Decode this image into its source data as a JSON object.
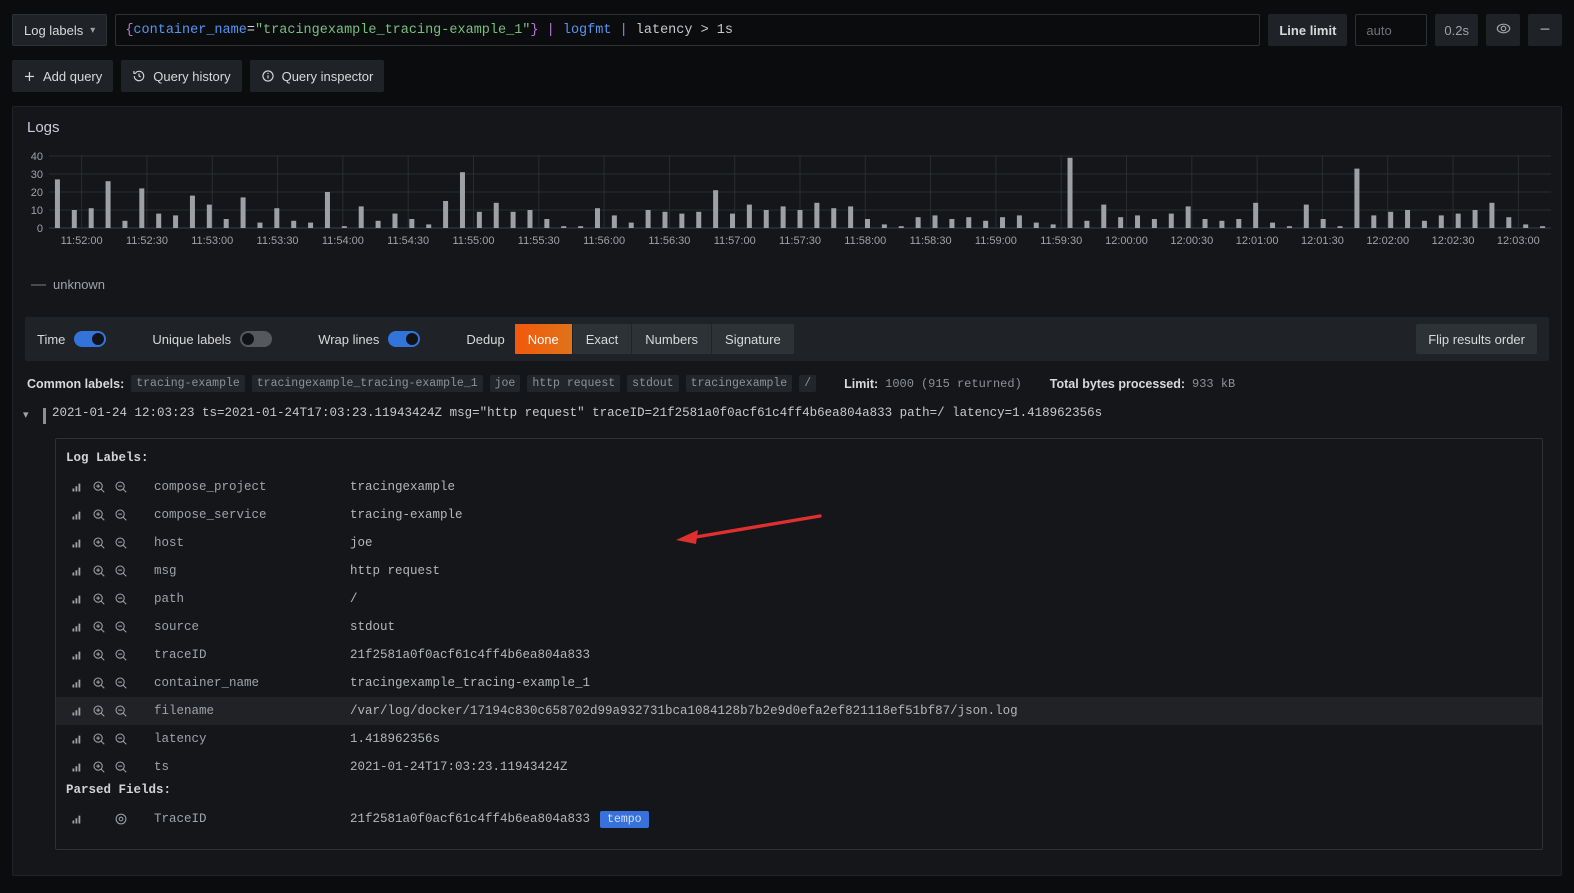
{
  "toolbar": {
    "log_labels_label": "Log labels",
    "chevron_icon": "chevron-down-icon",
    "query": {
      "brace_open": "{",
      "label": "container_name",
      "equals": "=",
      "string": "\"tracingexample_tracing-example_1\"",
      "brace_close": "}",
      "pipe1": "|",
      "parser": "logfmt",
      "pipe2": "|",
      "filter": "latency > 1s"
    },
    "line_limit_label": "Line limit",
    "line_limit_placeholder": "auto",
    "interval": "0.2s",
    "eye_icon": "eye-icon",
    "collapse_icon": "minus-icon"
  },
  "actions": [
    {
      "label": "Add query",
      "icon": "plus-icon"
    },
    {
      "label": "Query history",
      "icon": "history-icon"
    },
    {
      "label": "Query inspector",
      "icon": "info-circle-icon"
    }
  ],
  "panel": {
    "title": "Logs",
    "legend": {
      "dash": "—",
      "label": "unknown"
    }
  },
  "chart_data": {
    "type": "bar",
    "title": "Logs",
    "xlabel": "",
    "ylabel": "",
    "ylim": [
      0,
      40
    ],
    "yticks": [
      0,
      10,
      20,
      30,
      40
    ],
    "grid": true,
    "legend_position": "bottom-left",
    "series": [
      {
        "name": "unknown",
        "color": "#9da0a4"
      }
    ],
    "xtick_labels": [
      "11:52:00",
      "11:52:30",
      "11:53:00",
      "11:53:30",
      "11:54:00",
      "11:54:30",
      "11:55:00",
      "11:55:30",
      "11:56:00",
      "11:56:30",
      "11:57:00",
      "11:57:30",
      "11:58:00",
      "11:58:30",
      "11:59:00",
      "11:59:30",
      "12:00:00",
      "12:00:30",
      "12:01:00",
      "12:01:30",
      "12:02:00",
      "12:02:30",
      "12:03:00"
    ],
    "values": [
      27,
      10,
      11,
      26,
      4,
      22,
      8,
      7,
      18,
      13,
      5,
      17,
      3,
      11,
      4,
      3,
      20,
      1,
      12,
      4,
      8,
      5,
      2,
      15,
      31,
      9,
      14,
      9,
      10,
      5,
      1,
      1,
      11,
      7,
      3,
      10,
      9,
      8,
      9,
      21,
      8,
      13,
      10,
      12,
      10,
      14,
      11,
      12,
      5,
      2,
      1,
      6,
      7,
      5,
      6,
      4,
      6,
      7,
      3,
      2,
      39,
      4,
      13,
      6,
      7,
      5,
      8,
      12,
      5,
      4,
      5,
      14,
      3,
      1,
      13,
      5,
      1,
      33,
      7,
      9,
      10,
      4,
      7,
      8,
      10,
      14,
      6,
      2,
      1
    ]
  },
  "log_options": {
    "time_label": "Time",
    "time_on": true,
    "unique_labels_label": "Unique labels",
    "unique_labels_on": false,
    "wrap_lines_label": "Wrap lines",
    "wrap_lines_on": true,
    "dedup_label": "Dedup",
    "dedup_options": [
      "None",
      "Exact",
      "Numbers",
      "Signature"
    ],
    "dedup_selected": "None",
    "flip_label": "Flip results order"
  },
  "meta": {
    "common_labels_label": "Common labels:",
    "common_labels": [
      "tracing-example",
      "tracingexample_tracing-example_1",
      "joe",
      "http request",
      "stdout",
      "tracingexample",
      "/"
    ],
    "limit_label": "Limit:",
    "limit_value": "1000",
    "returned": "(915 returned)",
    "bytes_label": "Total bytes processed:",
    "bytes_value": "933 kB"
  },
  "log_entry": {
    "chevron_icon": "chevron-down-icon",
    "line": "2021-01-24 12:03:23 ts=2021-01-24T17:03:23.11943424Z msg=\"http request\" traceID=21f2581a0f0acf61c4ff4b6ea804a833 path=/ latency=1.418962356s"
  },
  "details": {
    "log_labels_heading": "Log Labels:",
    "parsed_fields_heading": "Parsed Fields:",
    "stats_icon": "bar-chart-icon",
    "zoom_in_icon": "search-plus-icon",
    "zoom_out_icon": "search-minus-icon",
    "detect_icon": "eye-target-icon",
    "labels": [
      {
        "key": "compose_project",
        "value": "tracingexample"
      },
      {
        "key": "compose_service",
        "value": "tracing-example"
      },
      {
        "key": "host",
        "value": "joe"
      },
      {
        "key": "msg",
        "value": "http request"
      },
      {
        "key": "path",
        "value": "/"
      },
      {
        "key": "source",
        "value": "stdout"
      },
      {
        "key": "traceID",
        "value": "21f2581a0f0acf61c4ff4b6ea804a833"
      },
      {
        "key": "container_name",
        "value": "tracingexample_tracing-example_1"
      },
      {
        "key": "filename",
        "value": "/var/log/docker/17194c830c658702d99a932731bca1084128b7b2e9d0efa2ef821118ef51bf87/json.log",
        "highlight": true
      },
      {
        "key": "latency",
        "value": "1.418962356s"
      },
      {
        "key": "ts",
        "value": "2021-01-24T17:03:23.11943424Z"
      }
    ],
    "parsed": [
      {
        "key": "TraceID",
        "value": "21f2581a0f0acf61c4ff4b6ea804a833",
        "badge": "tempo"
      }
    ]
  },
  "colors": {
    "accent_blue": "#3274d9",
    "dedup_active": "#f2580b",
    "bar_color": "#9da0a4",
    "tempo_badge": "#3871dc",
    "annotation_arrow": "#e02f2f"
  }
}
